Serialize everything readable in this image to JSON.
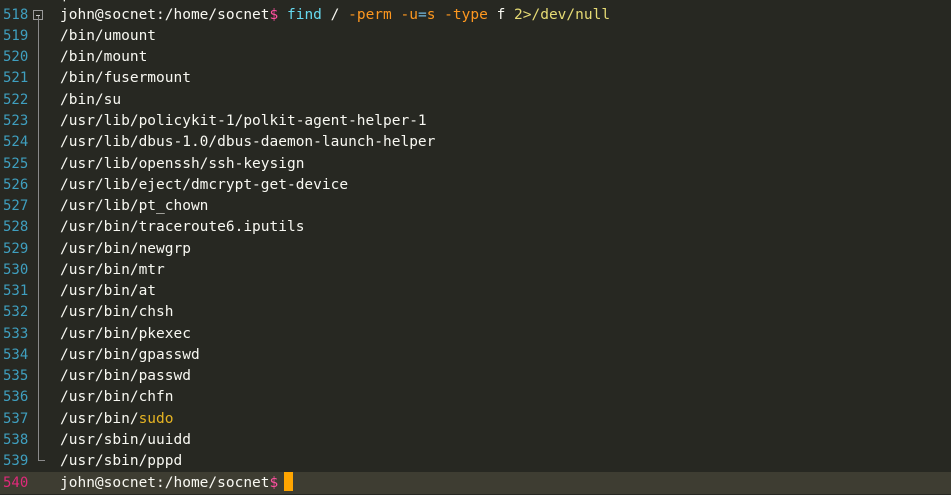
{
  "colors": {
    "background": "#272822",
    "current_line": "#3e3d32",
    "line_number": "#3f9fbf",
    "current_line_number": "#e0297a",
    "prompt_sign": "#ff4fa0",
    "command": "#66d9ef",
    "option": "#fd971f",
    "string": "#e6db74",
    "cursor": "#ffa500"
  },
  "command_line": {
    "number": "518",
    "prompt": "john@socnet:/home/socnet",
    "sign": "$",
    "cmd": "find",
    "arg_path": "/",
    "opt_perm": "-perm",
    "opt_u": "-u",
    "eq": "=",
    "opt_s": "s",
    "opt_type": "-type",
    "type_val": "f",
    "redirect": "2>/dev/null"
  },
  "output_lines": [
    {
      "number": "519",
      "text": "/bin/umount"
    },
    {
      "number": "520",
      "text": "/bin/mount"
    },
    {
      "number": "521",
      "text": "/bin/fusermount"
    },
    {
      "number": "522",
      "text": "/bin/su"
    },
    {
      "number": "523",
      "text": "/usr/lib/policykit-1/polkit-agent-helper-1"
    },
    {
      "number": "524",
      "text": "/usr/lib/dbus-1.0/dbus-daemon-launch-helper"
    },
    {
      "number": "525",
      "text": "/usr/lib/openssh/ssh-keysign"
    },
    {
      "number": "526",
      "text": "/usr/lib/eject/dmcrypt-get-device"
    },
    {
      "number": "527",
      "text": "/usr/lib/pt_chown"
    },
    {
      "number": "528",
      "text": "/usr/bin/traceroute6.iputils"
    },
    {
      "number": "529",
      "text": "/usr/bin/newgrp"
    },
    {
      "number": "530",
      "text": "/usr/bin/mtr"
    },
    {
      "number": "531",
      "text": "/usr/bin/at"
    },
    {
      "number": "532",
      "text": "/usr/bin/chsh"
    },
    {
      "number": "533",
      "text": "/usr/bin/pkexec"
    },
    {
      "number": "534",
      "text": "/usr/bin/gpasswd"
    },
    {
      "number": "535",
      "text": "/usr/bin/passwd"
    },
    {
      "number": "536",
      "text": "/usr/bin/chfn"
    },
    {
      "number": "537",
      "text_prefix": "/usr/bin/",
      "text_highlight": "sudo"
    },
    {
      "number": "538",
      "text": "/usr/sbin/uuidd"
    },
    {
      "number": "539",
      "text": "/usr/sbin/pppd"
    }
  ],
  "prompt_line": {
    "number": "540",
    "prompt": "john@socnet:/home/socnet",
    "sign": "$"
  }
}
